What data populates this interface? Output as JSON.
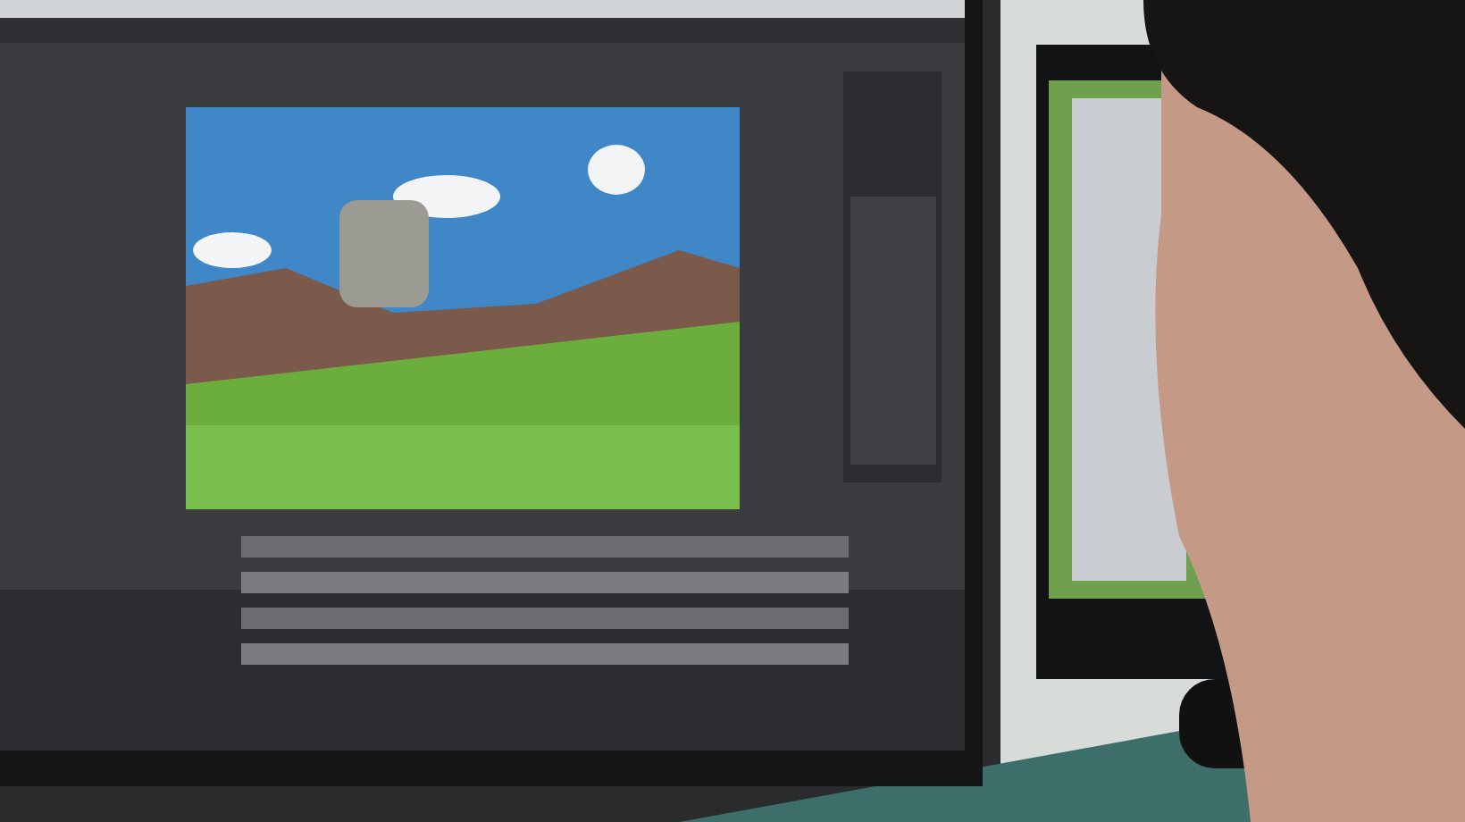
{
  "photo": {
    "kind": "monitor-scene"
  }
}
